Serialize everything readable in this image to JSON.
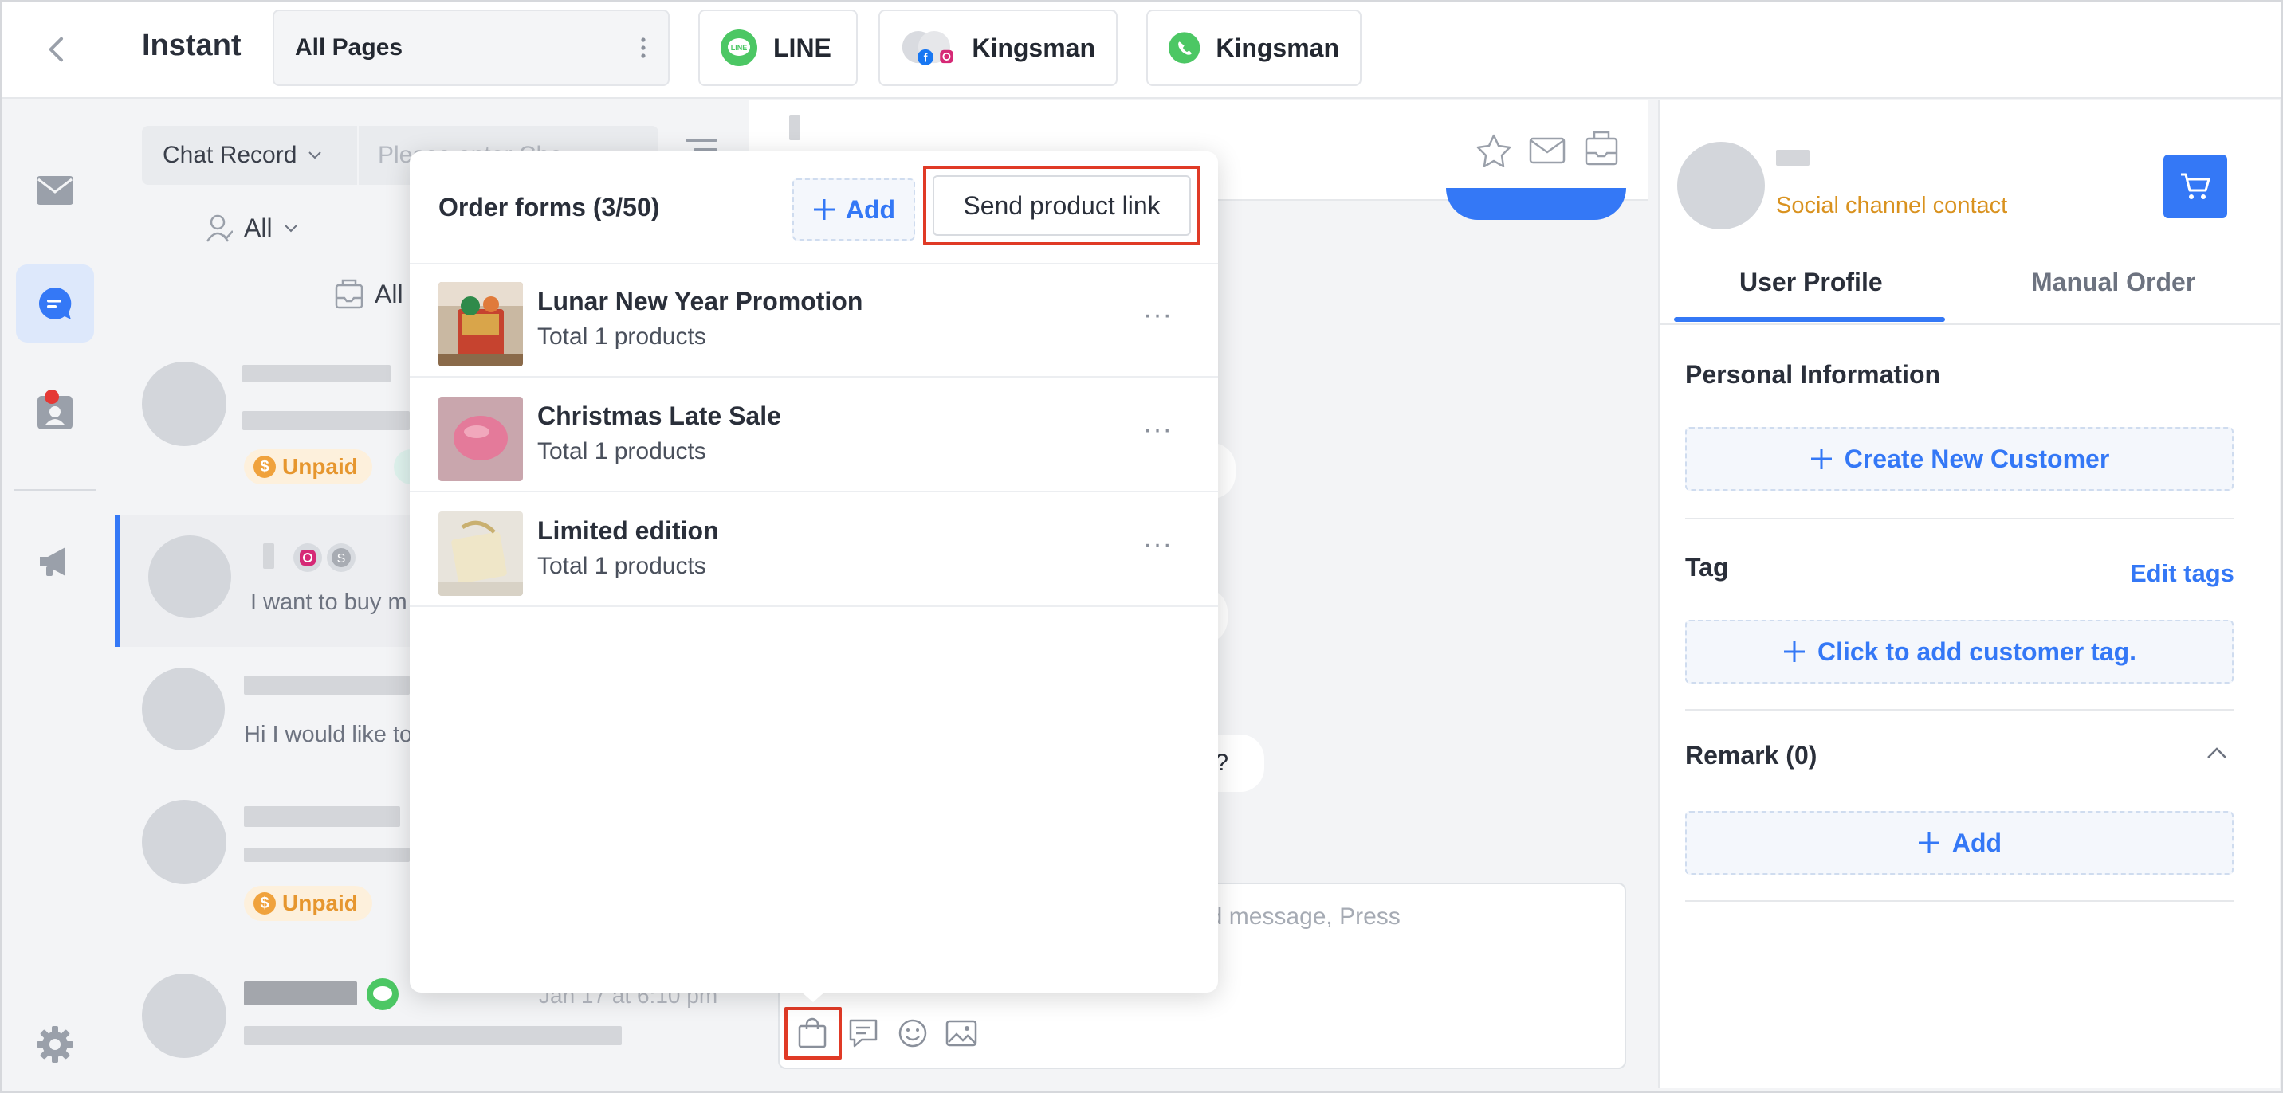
{
  "app": {
    "title": "Instant"
  },
  "header": {
    "page_select": "All Pages",
    "channel_tabs": [
      {
        "label": "LINE",
        "icon": "line-icon"
      },
      {
        "label": "Kingsman",
        "icon": "facebook-instagram-icon"
      },
      {
        "label": "Kingsman",
        "icon": "whatsapp-icon"
      }
    ]
  },
  "rail": {
    "items": [
      "mail-icon",
      "chat-icon",
      "contacts-icon",
      "megaphone-icon",
      "settings-icon"
    ]
  },
  "list": {
    "search_select": "Chat Record",
    "search_placeholder": "Please enter Che",
    "filter_user": "All",
    "filter_box": "All",
    "rows": [
      {
        "badge": "Unpaid"
      },
      {
        "preview": "I want to buy m"
      },
      {
        "preview": "Hi I would like to"
      },
      {
        "badge": "Unpaid"
      },
      {
        "time": "Jan 17 at 6:10 pm"
      }
    ]
  },
  "chat": {
    "bubble_tail": "t?",
    "composer_hint_1": "nd message, Press",
    "composer_hint_2": ")"
  },
  "popup": {
    "title": "Order forms (3/50)",
    "add_label": "Add",
    "send_label": "Send product link",
    "orders": [
      {
        "name": "Lunar New Year Promotion",
        "sub": "Total 1 products"
      },
      {
        "name": "Christmas Late Sale",
        "sub": "Total 1 products"
      },
      {
        "name": "Limited edition",
        "sub": "Total 1 products"
      }
    ]
  },
  "profile": {
    "contact_type": "Social channel contact",
    "tabs": [
      "User Profile",
      "Manual Order"
    ],
    "personal_title": "Personal Information",
    "create_customer": "Create New Customer",
    "tag_title": "Tag",
    "edit_tags": "Edit tags",
    "add_tag": "Click to add customer tag.",
    "remark_title": "Remark (0)",
    "remark_add": "Add"
  },
  "colors": {
    "accent": "#3478f6",
    "highlight": "#e03a26",
    "warning": "#e6962e",
    "line_green": "#4cc764"
  }
}
